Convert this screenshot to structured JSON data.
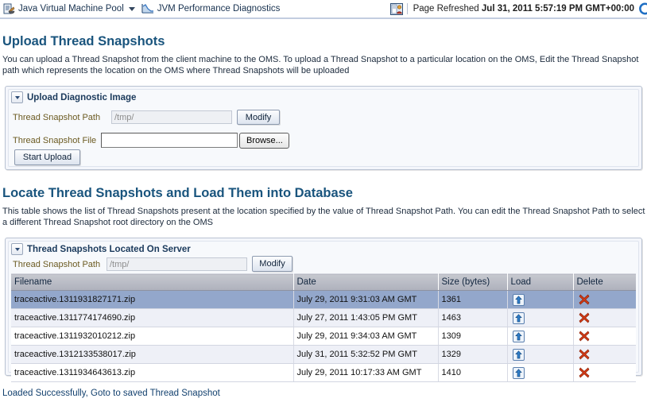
{
  "topbar": {
    "context_name": "Java Virtual Machine Pool",
    "context_icon": "jvm-pool-icon",
    "page_name": "JVM Performance Diagnostics",
    "page_icon": "performance-chart-icon",
    "user_icon": "user-preferences-icon",
    "refresh_prefix": "Page Refreshed",
    "refresh_time": "Jul 31, 2011 5:57:19 PM GMT+00:00",
    "refresh_icon": "refresh-icon"
  },
  "upload_section": {
    "heading": "Upload Thread Snapshots",
    "description": "You can upload a Thread Snapshot from the client machine to the OMS. To upload a Thread Snapshot to a particular location on the OMS, Edit the Thread Snapshot path which represents the location on the OMS where Thread Snapshots will be uploaded",
    "panel_title": "Upload Diagnostic Image",
    "path_label": "Thread Snapshot Path",
    "path_value": "/tmp/",
    "modify_label": "Modify",
    "file_label": "Thread Snapshot File",
    "file_value": "",
    "browse_label": "Browse...",
    "start_upload_label": "Start Upload"
  },
  "locate_section": {
    "heading": "Locate Thread Snapshots and Load Them into Database",
    "description": "This table shows the list of Thread Snapshots present at the location specified by the value of Thread Snapshot Path. You can edit the Thread Snapshot Path to select a different Thread Snapshot root directory on the OMS",
    "panel_title": "Thread Snapshots Located On Server",
    "path_label": "Thread Snapshot Path",
    "path_value": "/tmp/",
    "modify_label": "Modify"
  },
  "table": {
    "columns": [
      "Filename",
      "Date",
      "Size (bytes)",
      "Load",
      "Delete"
    ],
    "load_icon": "upload-arrow-icon",
    "delete_icon": "delete-x-icon",
    "rows": [
      {
        "filename": "traceactive.1311931827171.zip",
        "date": "July 29, 2011 9:31:03 AM GMT",
        "size": "1361",
        "selected": true
      },
      {
        "filename": "traceactive.1311774174690.zip",
        "date": "July 27, 2011 1:43:05 PM GMT",
        "size": "1463",
        "selected": false
      },
      {
        "filename": "traceactive.1311932010212.zip",
        "date": "July 29, 2011 9:34:03 AM GMT",
        "size": "1309",
        "selected": false
      },
      {
        "filename": "traceactive.1312133538017.zip",
        "date": "July 31, 2011 5:32:52 PM GMT",
        "size": "1329",
        "selected": false
      },
      {
        "filename": "traceactive.1311934643613.zip",
        "date": "July 29, 2011 10:17:33 AM GMT",
        "size": "1410",
        "selected": false
      }
    ]
  },
  "status_message": "Loaded Successfully, Goto to saved Thread Snapshot",
  "colors": {
    "heading": "#19547d",
    "label": "#6b5a21",
    "selected_row": "#93a7cb",
    "status": "#12406e"
  }
}
